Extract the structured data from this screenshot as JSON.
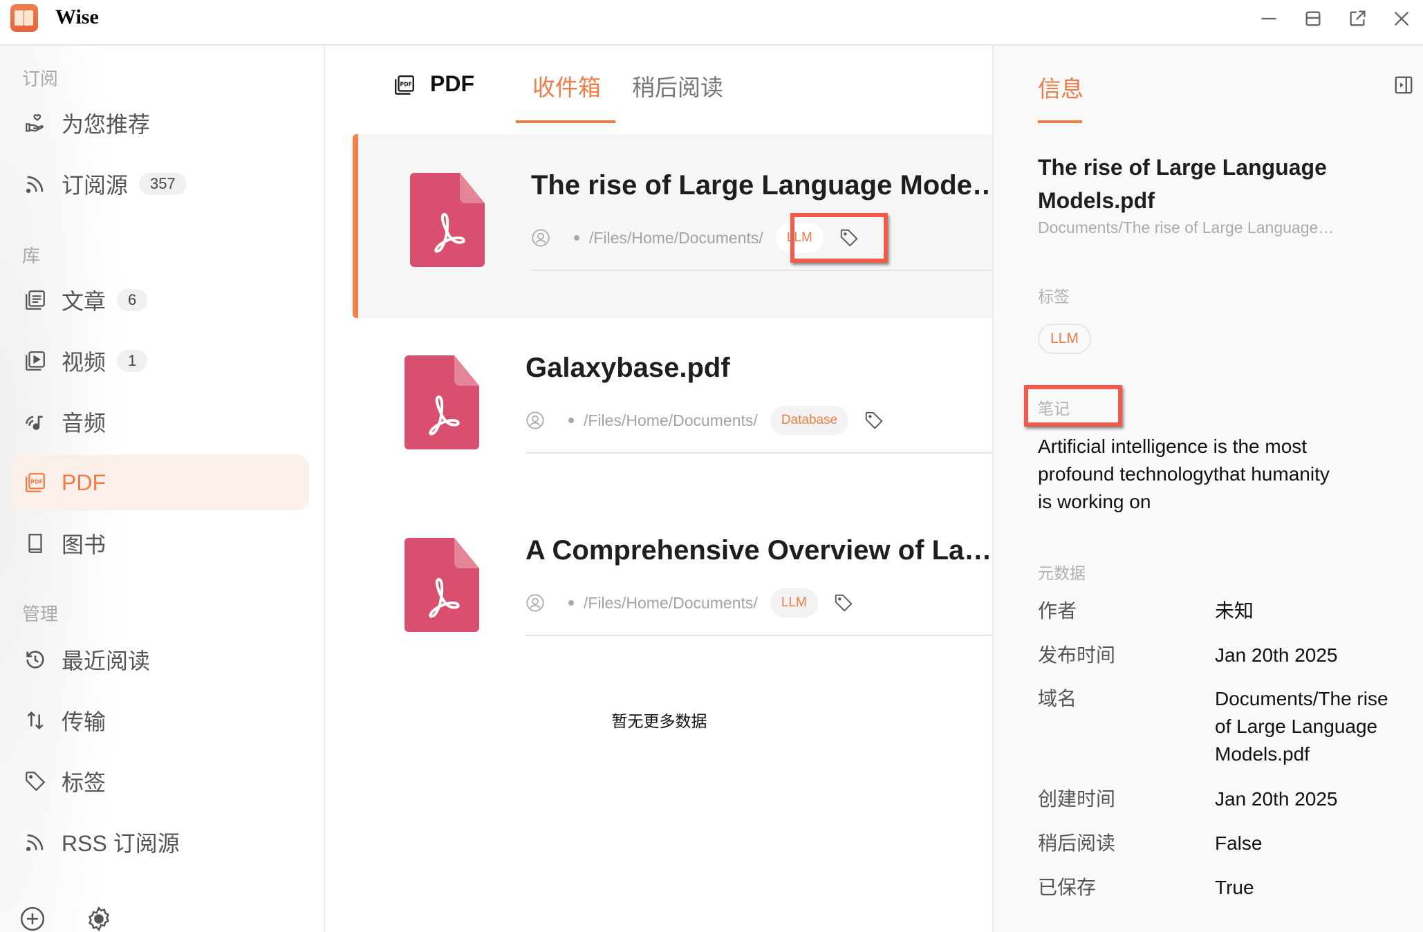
{
  "app": {
    "title": "Wise",
    "window_controls": [
      "minimize-icon",
      "maximize-icon",
      "popout-icon",
      "close-icon"
    ]
  },
  "sidebar": {
    "sections": [
      {
        "title": "订阅",
        "items": [
          {
            "label": "为您推荐",
            "icon": "heart-hand-icon"
          },
          {
            "label": "订阅源",
            "icon": "rss-icon",
            "badge": "357"
          }
        ]
      },
      {
        "title": "库",
        "items": [
          {
            "label": "文章",
            "icon": "article-icon",
            "badge": "6"
          },
          {
            "label": "视频",
            "icon": "video-icon",
            "badge": "1"
          },
          {
            "label": "音频",
            "icon": "audio-icon"
          },
          {
            "label": "PDF",
            "icon": "pdf-icon",
            "active": true
          },
          {
            "label": "图书",
            "icon": "book-icon"
          }
        ]
      },
      {
        "title": "管理",
        "items": [
          {
            "label": "最近阅读",
            "icon": "history-icon"
          },
          {
            "label": "传输",
            "icon": "transfer-icon"
          },
          {
            "label": "标签",
            "icon": "tag-icon"
          },
          {
            "label": "RSS 订阅源",
            "icon": "rss-icon"
          }
        ]
      }
    ],
    "bottom": [
      "add-icon",
      "settings-icon"
    ]
  },
  "center": {
    "header_title": "PDF",
    "tabs": [
      {
        "label": "收件箱",
        "active": true
      },
      {
        "label": "稍后阅读",
        "active": false
      }
    ],
    "items": [
      {
        "title": "The rise of Large Language Models.pdf",
        "path": "/Files/Home/Documents/",
        "tag": "LLM",
        "selected": true
      },
      {
        "title": "Galaxybase.pdf",
        "path": "/Files/Home/Documents/",
        "tag": "Database",
        "selected": false
      },
      {
        "title": "A Comprehensive Overview of Large Language Models.pdf",
        "path": "/Files/Home/Documents/",
        "tag": "LLM",
        "selected": false
      }
    ],
    "no_more": "暂无更多数据"
  },
  "info_panel": {
    "tab": "信息",
    "title": "The rise of Large Language Models.pdf",
    "subtitle": "Documents/The rise of Large Language…",
    "tags_label": "标签",
    "tags": [
      "LLM"
    ],
    "notes_label": "笔记",
    "note": "Artificial intelligence is the most profound technologythat humanity is working on",
    "metadata_label": "元数据",
    "metadata": [
      {
        "key": "作者",
        "value": "未知"
      },
      {
        "key": "发布时间",
        "value": "Jan 20th 2025"
      },
      {
        "key": "域名",
        "value": "Documents/The rise of Large Language Models.pdf"
      },
      {
        "key": "创建时间",
        "value": "Jan 20th 2025"
      },
      {
        "key": "稍后阅读",
        "value": "False"
      },
      {
        "key": "已保存",
        "value": "True"
      }
    ]
  },
  "colors": {
    "accent": "#ef7b45",
    "pdf_icon": "#d9506e",
    "annotation_box": "#f25a4a"
  }
}
